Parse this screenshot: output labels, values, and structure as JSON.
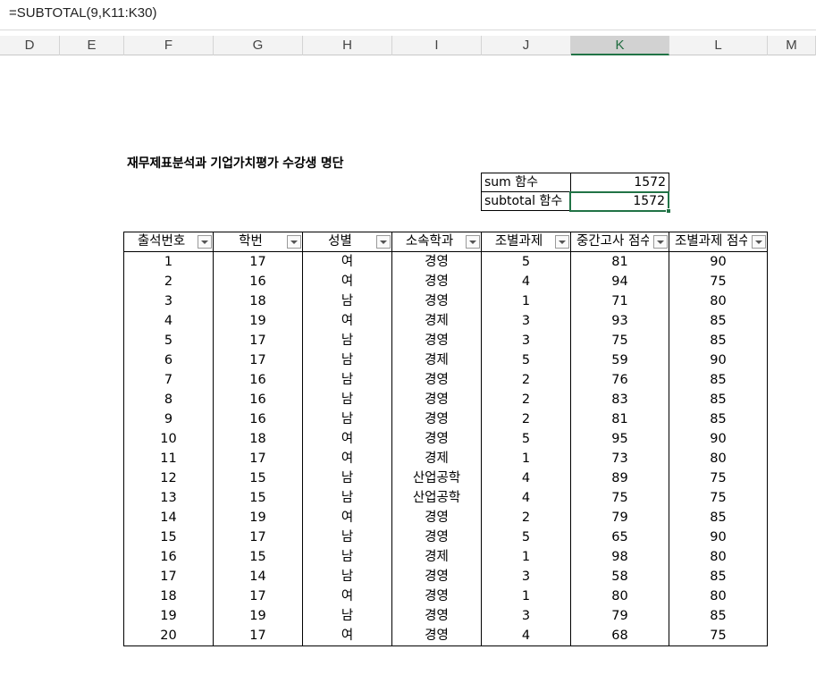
{
  "formula_bar": {
    "formula": "=SUBTOTAL(9,K11:K30)"
  },
  "columns": [
    "D",
    "E",
    "F",
    "G",
    "H",
    "I",
    "J",
    "K",
    "L",
    "M"
  ],
  "active_column": "K",
  "title": "재무제표분석과 기업가치평가 수강생 명단",
  "summary": {
    "sum_label": "sum 함수",
    "sum_value": "1572",
    "subtotal_label": "subtotal 함수",
    "subtotal_value": "1572"
  },
  "table": {
    "headers": [
      "출석번호",
      "학번",
      "성별",
      "소속학과",
      "조별과제 ",
      "중간고사 점수",
      "조별과제 점수"
    ],
    "rows": [
      [
        "1",
        "17",
        "여",
        "경영",
        "5",
        "81",
        "90"
      ],
      [
        "2",
        "16",
        "여",
        "경영",
        "4",
        "94",
        "75"
      ],
      [
        "3",
        "18",
        "남",
        "경영",
        "1",
        "71",
        "80"
      ],
      [
        "4",
        "19",
        "여",
        "경제",
        "3",
        "93",
        "85"
      ],
      [
        "5",
        "17",
        "남",
        "경영",
        "3",
        "75",
        "85"
      ],
      [
        "6",
        "17",
        "남",
        "경제",
        "5",
        "59",
        "90"
      ],
      [
        "7",
        "16",
        "남",
        "경영",
        "2",
        "76",
        "85"
      ],
      [
        "8",
        "16",
        "남",
        "경영",
        "2",
        "83",
        "85"
      ],
      [
        "9",
        "16",
        "남",
        "경영",
        "2",
        "81",
        "85"
      ],
      [
        "10",
        "18",
        "여",
        "경영",
        "5",
        "95",
        "90"
      ],
      [
        "11",
        "17",
        "여",
        "경제",
        "1",
        "73",
        "80"
      ],
      [
        "12",
        "15",
        "남",
        "산업공학",
        "4",
        "89",
        "75"
      ],
      [
        "13",
        "15",
        "남",
        "산업공학",
        "4",
        "75",
        "75"
      ],
      [
        "14",
        "19",
        "여",
        "경영",
        "2",
        "79",
        "85"
      ],
      [
        "15",
        "17",
        "남",
        "경영",
        "5",
        "65",
        "90"
      ],
      [
        "16",
        "15",
        "남",
        "경제",
        "1",
        "98",
        "80"
      ],
      [
        "17",
        "14",
        "남",
        "경영",
        "3",
        "58",
        "85"
      ],
      [
        "18",
        "17",
        "여",
        "경영",
        "1",
        "80",
        "80"
      ],
      [
        "19",
        "19",
        "남",
        "경영",
        "3",
        "79",
        "85"
      ],
      [
        "20",
        "17",
        "여",
        "경영",
        "4",
        "68",
        "75"
      ]
    ]
  }
}
